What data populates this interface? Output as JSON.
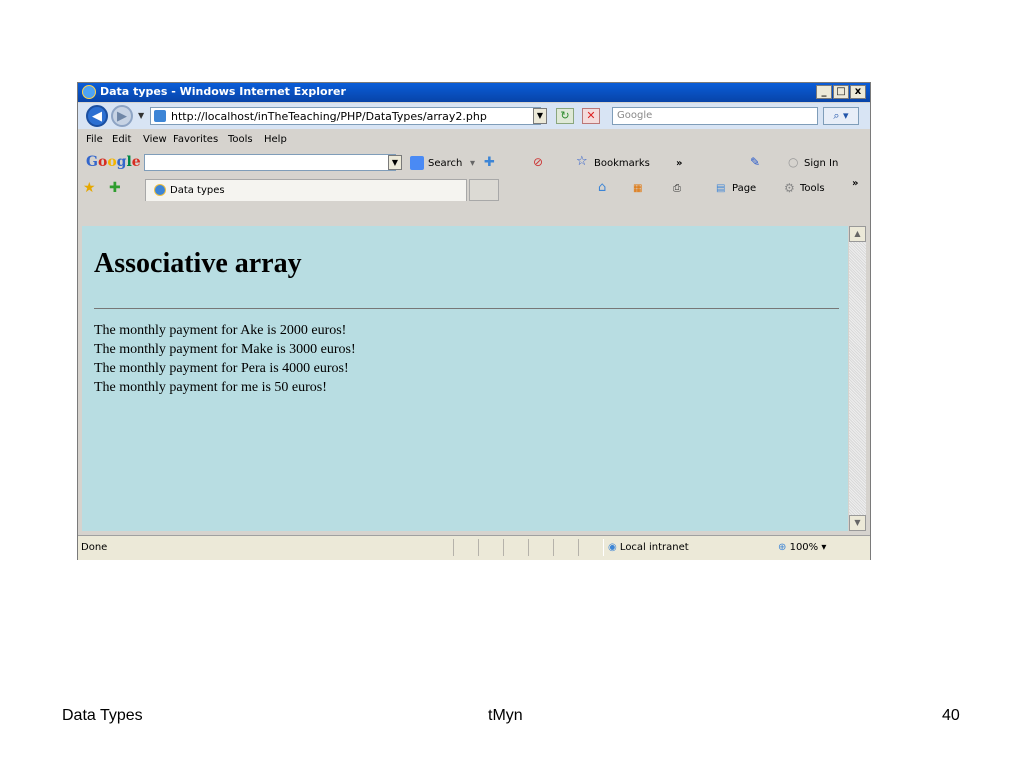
{
  "window": {
    "title": "Data types - Windows Internet Explorer",
    "minimize": "_",
    "maximize": "□",
    "close": "x"
  },
  "address_bar": {
    "url": "http://localhost/inTheTeaching/PHP/DataTypes/array2.php",
    "search_placeholder": "Google",
    "search_icon": "magnifier-icon"
  },
  "menu": [
    "File",
    "Edit",
    "View",
    "Favorites",
    "Tools",
    "Help"
  ],
  "google_toolbar": {
    "logo": "Google",
    "search_label": "Search",
    "bookmarks_label": "Bookmarks",
    "more": "»",
    "sign_in": "Sign In"
  },
  "tab": {
    "label": "Data types"
  },
  "command_bar": {
    "page_label": "Page",
    "tools_label": "Tools",
    "more": "»"
  },
  "content": {
    "heading": "Associative array",
    "lines": [
      "The monthly payment for Ake is 2000 euros!",
      "The monthly payment for Make is 3000 euros!",
      "The monthly payment for Pera is 4000 euros!",
      "The monthly payment for me is 50 euros!"
    ]
  },
  "status_bar": {
    "status": "Done",
    "zone": "Local intranet",
    "zoom": "100%"
  },
  "slide_footer": {
    "left": "Data Types",
    "center": "tMyn",
    "page": "40"
  }
}
